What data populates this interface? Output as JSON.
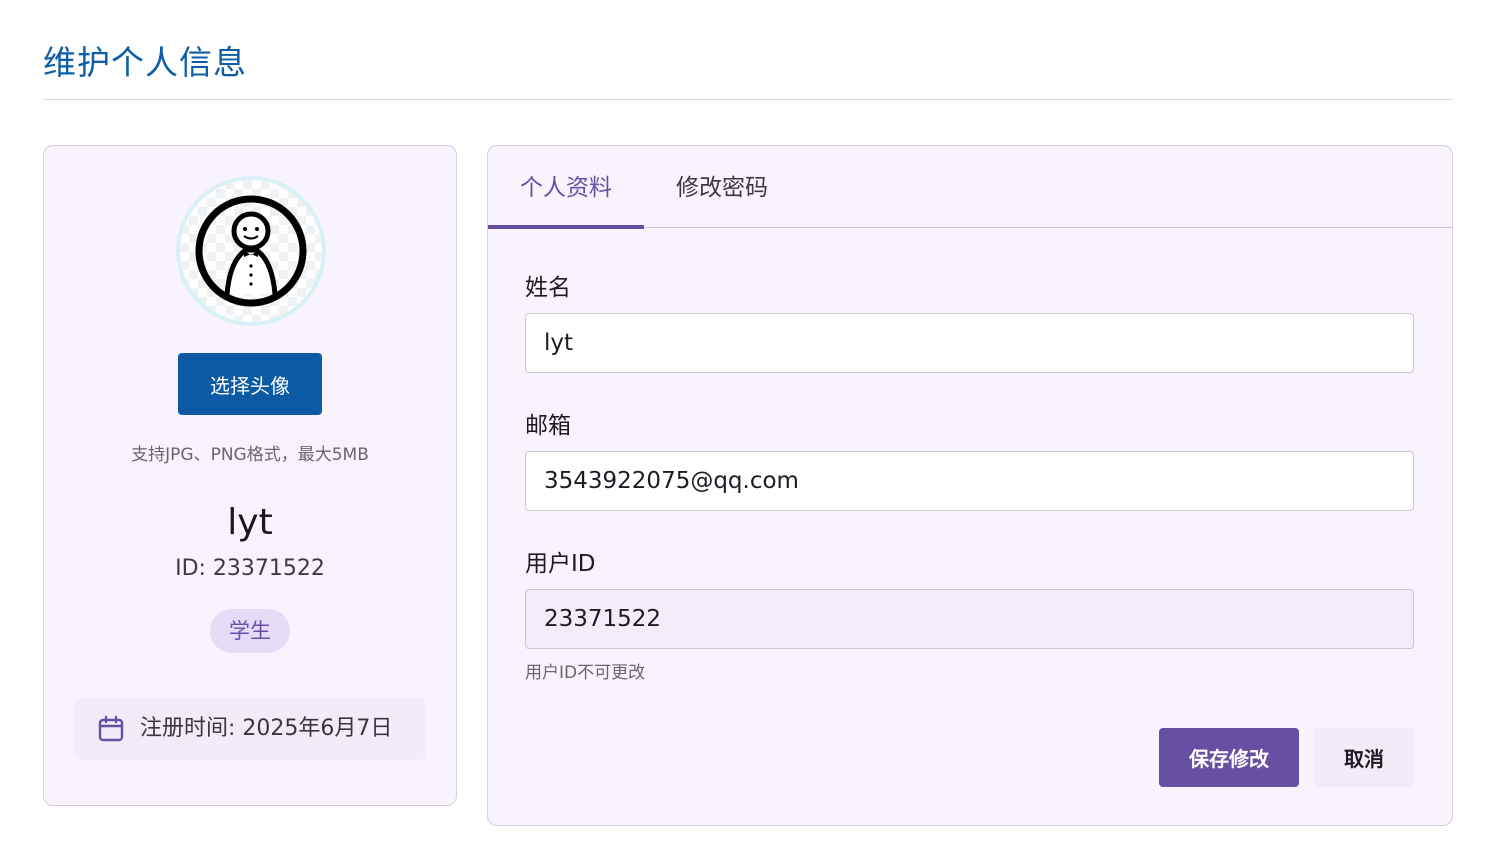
{
  "page": {
    "title": "维护个人信息"
  },
  "profile": {
    "choose_avatar_label": "选择头像",
    "avatar_hint": "支持JPG、PNG格式，最大5MB",
    "name": "lyt",
    "id_text": "ID: 23371522",
    "role": "学生",
    "register_text": "注册时间: 2025年6月7日",
    "calendar_icon": "calendar-icon"
  },
  "tabs": [
    {
      "label": "个人资料",
      "active": true
    },
    {
      "label": "修改密码",
      "active": false
    }
  ],
  "form": {
    "name_label": "姓名",
    "name_value": "lyt",
    "email_label": "邮箱",
    "email_value": "3543922075@qq.com",
    "userid_label": "用户ID",
    "userid_value": "23371522",
    "userid_hint": "用户ID不可更改",
    "save_label": "保存修改",
    "cancel_label": "取消"
  },
  "colors": {
    "title": "#0d5ea6",
    "primary_blue": "#0b5aa3",
    "accent_purple": "#6750a4",
    "card_bg": "#f8f3fc",
    "badge_bg": "#e6dcf8"
  }
}
